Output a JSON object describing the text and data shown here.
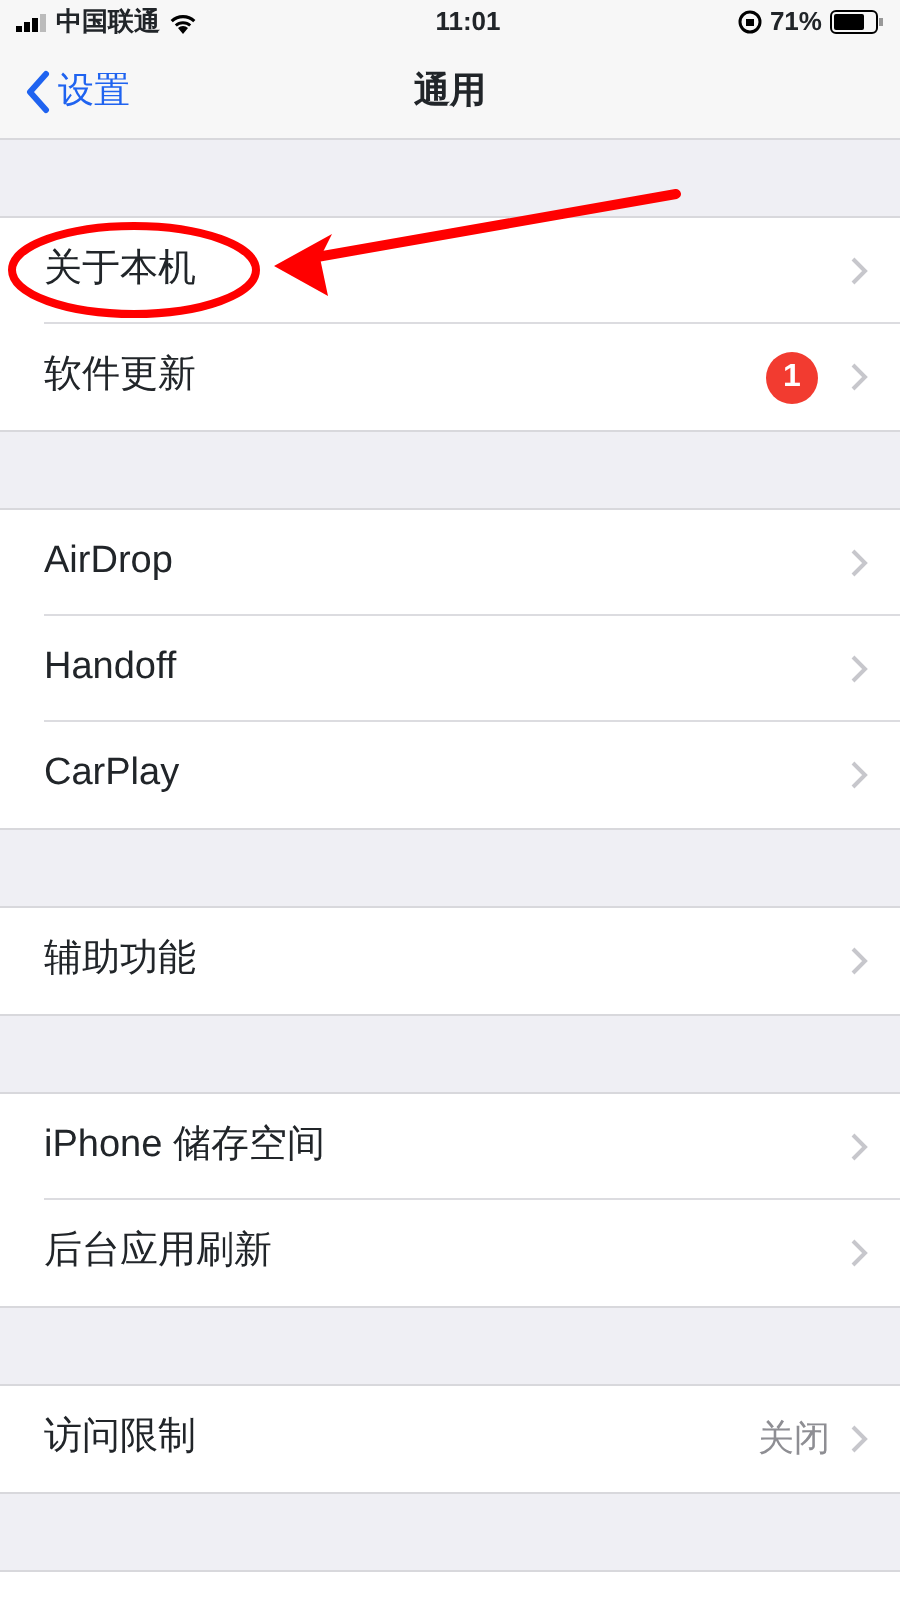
{
  "status_bar": {
    "carrier": "中国联通",
    "time": "11:01",
    "battery": "71%"
  },
  "nav": {
    "back": "设置",
    "title": "通用"
  },
  "groups": [
    [
      {
        "label": "关于本机"
      },
      {
        "label": "软件更新",
        "badge": "1"
      }
    ],
    [
      {
        "label": "AirDrop"
      },
      {
        "label": "Handoff"
      },
      {
        "label": "CarPlay"
      }
    ],
    [
      {
        "label": "辅助功能"
      }
    ],
    [
      {
        "label": "iPhone 储存空间"
      },
      {
        "label": "后台应用刷新"
      }
    ],
    [
      {
        "label": "访问限制",
        "value": "关闭"
      }
    ]
  ]
}
